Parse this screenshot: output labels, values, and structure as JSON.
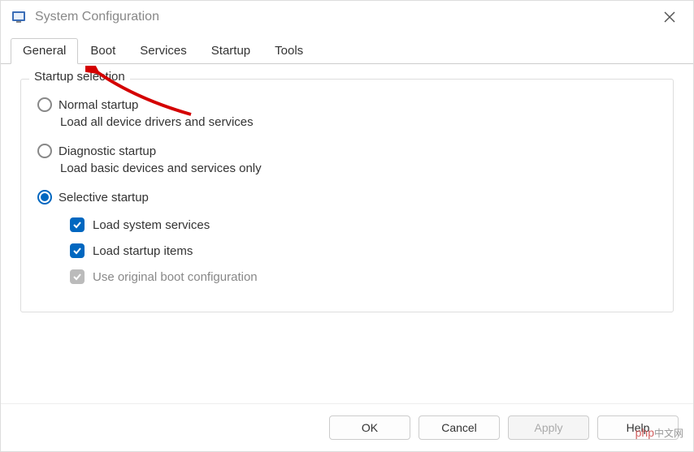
{
  "window": {
    "title": "System Configuration"
  },
  "tabs": {
    "general": "General",
    "boot": "Boot",
    "services": "Services",
    "startup": "Startup",
    "tools": "Tools"
  },
  "group": {
    "title": "Startup selection",
    "normal": {
      "label": "Normal startup",
      "desc": "Load all device drivers and services",
      "selected": false
    },
    "diagnostic": {
      "label": "Diagnostic startup",
      "desc": "Load basic devices and services only",
      "selected": false
    },
    "selective": {
      "label": "Selective startup",
      "selected": true,
      "load_system_services": {
        "label": "Load system services",
        "checked": true
      },
      "load_startup_items": {
        "label": "Load startup items",
        "checked": true
      },
      "use_original_boot": {
        "label": "Use original boot configuration",
        "checked": true,
        "disabled": true
      }
    }
  },
  "buttons": {
    "ok": "OK",
    "cancel": "Cancel",
    "apply": "Apply",
    "help": "Help"
  },
  "watermark": {
    "brand": "php",
    "cn": "中文网"
  }
}
